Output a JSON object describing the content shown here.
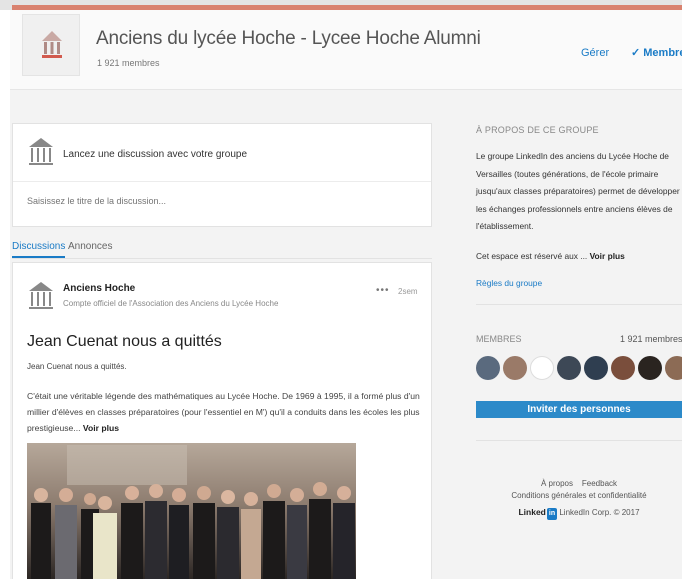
{
  "group": {
    "title": "Anciens du lycée Hoche - Lycee Hoche Alumni",
    "member_count": "1 921 membres",
    "manage_label": "Gérer",
    "member_status_label": "✓ Membre"
  },
  "composer": {
    "prompt": "Lancez une discussion avec votre groupe",
    "title_placeholder": "Saisissez le titre de la discussion..."
  },
  "tabs": [
    {
      "label": "Discussions",
      "active": true
    },
    {
      "label": "Annonces",
      "active": false
    }
  ],
  "post": {
    "author": "Anciens Hoche",
    "author_desc": "Compte officiel de l'Association des Anciens du Lycée Hoche",
    "menu": "•••",
    "time": "2sem",
    "title": "Jean Cuenat nous a quittés",
    "subtitle": "Jean Cuenat nous a quittés.",
    "body": "C'était une véritable légende des mathématiques au Lycée Hoche. De 1969 à 1995, il a formé plus d'un millier d'élèves en classes préparatoires (pour l'essentiel en M') qu'il a conduits dans les écoles les plus prestigieuse...",
    "more_label": "Voir plus"
  },
  "about": {
    "heading": "À PROPOS DE CE GROUPE",
    "text": "Le groupe LinkedIn des anciens du Lycée Hoche de Versailles (toutes générations, de l'école primaire jusqu'aux classes préparatoires) permet de développer les échanges professionnels entre anciens élèves de l'établissement.",
    "reserved": "Cet espace est réservé aux ...",
    "more_label": "Voir plus",
    "rules_label": "Règles du groupe"
  },
  "members": {
    "heading": "MEMBRES",
    "count": "1 921 membres",
    "invite_label": "Inviter des personnes"
  },
  "footer": {
    "about": "À propos",
    "feedback": "Feedback",
    "terms": "Conditions générales et confidentialité",
    "brand_text": "Linked",
    "brand_box": "in",
    "copyright": "LinkedIn Corp. © 2017"
  },
  "colors": {
    "accent_bar": "#d9826f",
    "link_blue": "#1a7bc6",
    "invite_button": "#2c8ac9"
  },
  "icons": {
    "group_logo": "building-pillars-icon",
    "post_author": "building-pillars-icon"
  }
}
